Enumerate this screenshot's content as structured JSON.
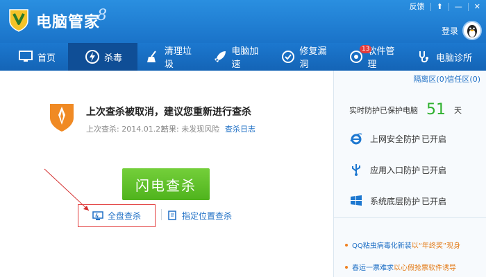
{
  "app": {
    "title": "电脑管家",
    "window_controls": [
      "反馈",
      "⬆",
      "—",
      "✕"
    ],
    "login": "登录"
  },
  "nav": {
    "items": [
      {
        "label": "首页",
        "icon": "monitor-icon"
      },
      {
        "label": "杀毒",
        "icon": "lightning-shield-icon",
        "active": true
      },
      {
        "label": "清理垃圾",
        "icon": "broom-icon"
      },
      {
        "label": "电脑加速",
        "icon": "rocket-icon"
      },
      {
        "label": "修复漏洞",
        "icon": "patch-icon"
      },
      {
        "label": "软件管理",
        "icon": "apps-icon",
        "badge": "13"
      },
      {
        "label": "电脑诊所",
        "icon": "stethoscope-icon"
      }
    ]
  },
  "scan": {
    "warning_title": "上次查杀被取消，建议您重新进行查杀",
    "last_scan": "上次查杀: 2014.01.22",
    "result": "结果: 未发现风险",
    "log_link": "查杀日志",
    "flash_button": "闪电查杀",
    "full_scan": "全盘查杀",
    "custom_scan": "指定位置查杀"
  },
  "right": {
    "quarantine": "隔离区(0)",
    "trust": "信任区(0)",
    "protect_label": "实时防护已保护电脑",
    "protect_days": "51",
    "protect_unit": "天",
    "features": [
      {
        "name": "上网安全防护",
        "status": "已开启",
        "icon": "ie-icon"
      },
      {
        "name": "应用入口防护",
        "status": "已开启",
        "icon": "usb-icon"
      },
      {
        "name": "系统底层防护",
        "status": "已开启",
        "icon": "windows-icon"
      }
    ],
    "news": [
      {
        "a": "QQ粘虫病毒化新装",
        "b": "以“年终奖”现身"
      },
      {
        "a": "春运一票难求",
        "b": "以心假抢票软件诱导"
      }
    ]
  },
  "colors": {
    "accent": "#1a73c9",
    "green": "#4fb31d",
    "red": "#e23b3b",
    "link": "#1e6fc5"
  }
}
